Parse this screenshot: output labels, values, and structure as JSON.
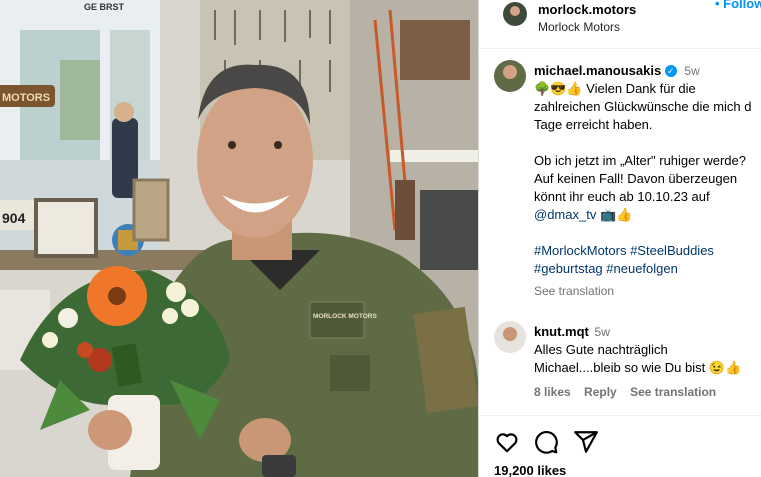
{
  "header": {
    "account": "morlock.motors",
    "subtitle": "Morlock Motors",
    "follow_label": "• Follow"
  },
  "caption": {
    "username": "michael.manousakis",
    "time": "5w",
    "lines": [
      "🌳😎👍 Vielen Dank für die",
      "zahlreichen Glückwünsche die mich d",
      "Tage erreicht haben.",
      "",
      "Ob ich jetzt im „Alter\" ruhiger werde?",
      "Auf keinen Fall! Davon überzeugen",
      "könnt ihr euch ab 10.10.23 auf",
      "@dmax_tv 📺👍",
      "",
      "#MorlockMotors #SteelBuddies",
      "#geburtstag #neuefolgen"
    ],
    "see_translation": "See translation"
  },
  "comment": {
    "username": "knut.mqt",
    "time": "5w",
    "line1": "Alles Gute nachträglich",
    "line2": "Michael....bleib so wie Du bist 😉👍",
    "likes": "8 likes",
    "reply": "Reply",
    "see_translation": "See translation"
  },
  "footer": {
    "likes": "19,200 likes",
    "icons": [
      "heart-icon",
      "comment-icon",
      "share-icon"
    ]
  },
  "photo": {
    "sign_text": "MOTORS",
    "badge_text": "MORLOCK MOTORS",
    "badge_chest": "MORLOCK MOTORS",
    "plate_text": "904",
    "shop_text": "GE BRST"
  },
  "colors": {
    "verified": "#0095f6",
    "follow": "#0095f6",
    "link": "#00376b",
    "muted": "#737373"
  }
}
